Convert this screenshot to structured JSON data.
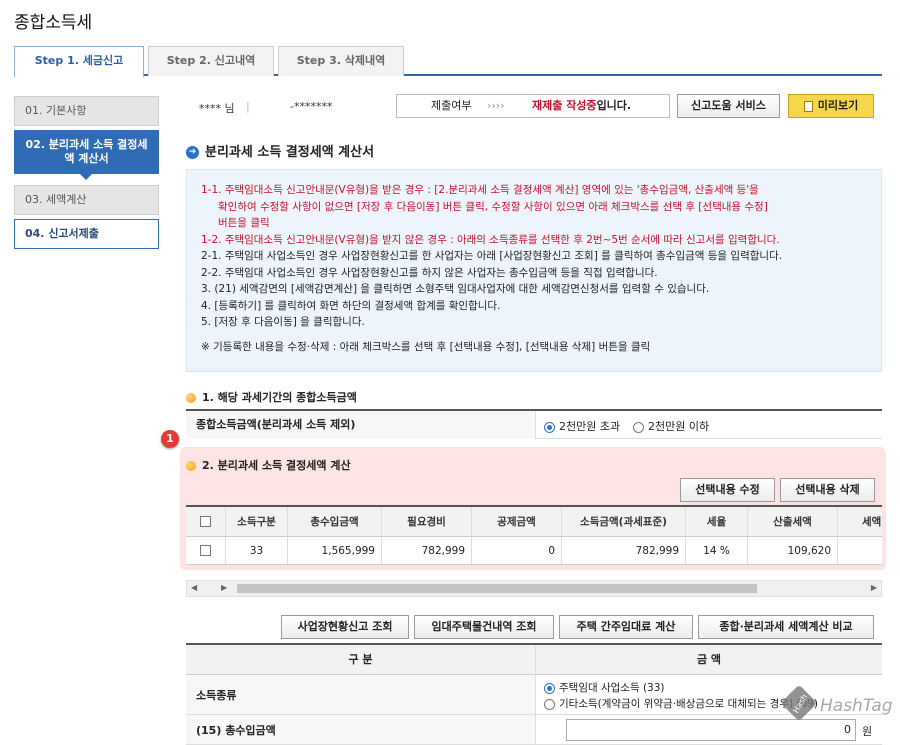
{
  "page_title": "종합소득세",
  "tabs": [
    {
      "label": "Step 1. 세금신고"
    },
    {
      "label": "Step 2. 신고내역"
    },
    {
      "label": "Step 3. 삭제내역"
    }
  ],
  "sidebar": [
    {
      "label": "01. 기본사항"
    },
    {
      "label": "02. 분리과세 소득 결정세액 계산서"
    },
    {
      "label": "03. 세액계산"
    },
    {
      "label": "04. 신고서제출"
    }
  ],
  "userbar": {
    "user_name": "**** 님",
    "user_id": "-*******",
    "status_label": "제출여부",
    "status_arrows": "››››",
    "status_value_red": "재제출 작성중",
    "status_value_suffix": "입니다.",
    "help_button": "신고도움 서비스",
    "preview_button": "미리보기"
  },
  "section_title": "분리과세 소득 결정세액 계산서",
  "notice": {
    "line1": "1-1. 주택임대소득 신고안내문(V유형)을 받은 경우 : [2.분리과세 소득 결정세액 계산] 영역에 있는 '총수입금액, 산출세액 등'을",
    "line1b": "확인하여 수정할 사항이 없으면 [저장 후 다음이동] 버튼 클릭, 수정할 사항이 있으면 아래 체크박스를 선택 후 [선택내용 수정]",
    "line1c": "버튼을 클릭",
    "line2": "1-2. 주택임대소득 신고안내문(V유형)을 받지 않은 경우 : 아래의 소득종류를 선택한 후 2번~5번 순서에 따라 신고서를 입력합니다.",
    "line3": "2-1. 주택임대 사업소득인 경우 사업장현황신고를 한 사업자는 아래 [사업장현황신고 조회] 를 클릭하여 총수입금액 등을 입력합니다.",
    "line4": "2-2. 주택임대 사업소득인 경우 사업장현황신고를 하지 않은 사업자는 총수입금액 등을 직접 입력합니다.",
    "line5": "3. (21) 세액감면의 [세액감면계산] 을 클릭하면 소형주택 임대사업자에 대한 세액감면신청서를 입력할 수 있습니다.",
    "line6": "4. [등록하기] 를 클릭하여 화면 하단의 결정세액 합계를 확인합니다.",
    "line7": "5. [저장 후 다음이동] 을 클릭합니다.",
    "line8": "※ 기등록한 내용을 수정·삭제 : 아래 체크박스를 선택 후 [선택내용 수정], [선택내용 삭제] 버튼을 클릭"
  },
  "section1": {
    "title": "1. 해당 과세기간의 종합소득금액",
    "row_label": "종합소득금액(분리과세 소득 제외)",
    "option_over": "2천만원 초과",
    "option_under": "2천만원 이하"
  },
  "section2": {
    "badge": "1",
    "title": "2. 분리과세 소득 결정세액 계산",
    "edit_button": "선택내용 수정",
    "delete_button": "선택내용 삭제",
    "headers": [
      "소득구분",
      "총수입금액",
      "필요경비",
      "공제금액",
      "소득금액(과세표준)",
      "세율",
      "산출세액",
      "세액"
    ],
    "row": [
      "33",
      "1,565,999",
      "782,999",
      "0",
      "782,999",
      "14 %",
      "109,620",
      ""
    ]
  },
  "action_buttons": [
    "사업장현황신고 조회",
    "임대주택물건내역 조회",
    "주택 간주임대료 계산",
    "종합·분리과세 세액계산 비교"
  ],
  "bottom_table": {
    "col1": "구 분",
    "col2": "금 액",
    "income_type_label": "소득종류",
    "income_option1": "주택임대 사업소득 (33)",
    "income_option2": "기타소득(계약금이 위약금·배상금으로 대체되는 경우) (69)",
    "revenue_label": "(15) 총수입금액",
    "revenue_value": "0",
    "revenue_unit": "원"
  },
  "watermark": {
    "text": "HashTag"
  },
  "colors": {
    "accent_blue": "#2f6cb5",
    "notice_red": "#c8102e",
    "highlight_pink": "#fde3e3",
    "preview_yellow": "#f6d64a"
  }
}
